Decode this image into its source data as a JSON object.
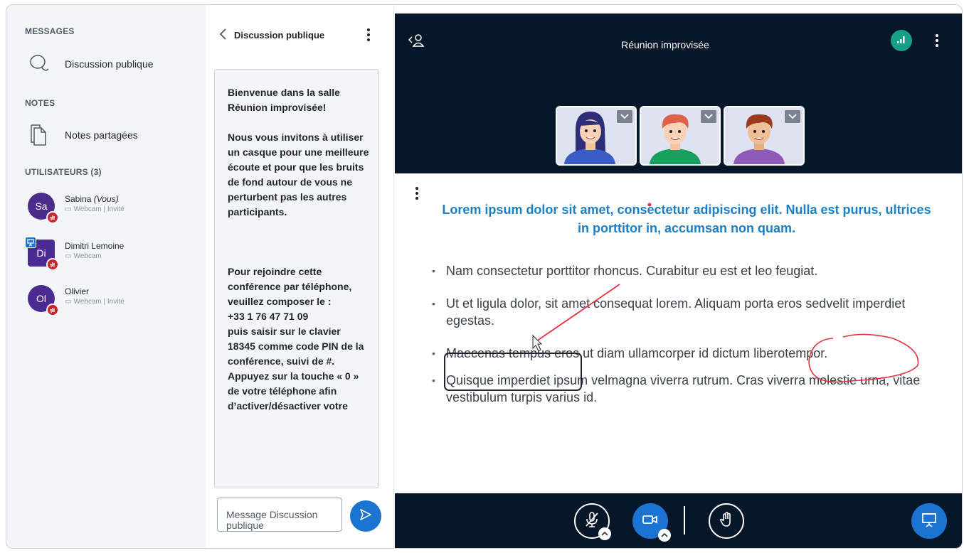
{
  "sidebar": {
    "messages_title": "MESSAGES",
    "public_chat_label": "Discussion publique",
    "notes_title": "NOTES",
    "shared_notes_label": "Notes partagées",
    "users_title": "UTILISATEURS (3)",
    "users": [
      {
        "initials": "Sa",
        "name": "Sabina",
        "you": "(Vous)",
        "status": "Webcam | Invité",
        "color": "#4a2c8a"
      },
      {
        "initials": "Di",
        "name": "Dimitri Lemoine",
        "you": "",
        "status": "Webcam",
        "color": "#4b2a91"
      },
      {
        "initials": "Ol",
        "name": "Olivier",
        "you": "",
        "status": "Webcam | Invité",
        "color": "#4b2a91"
      }
    ]
  },
  "chat": {
    "title": "Discussion publique",
    "welcome_lines": [
      "Bienvenue dans la salle Réunion improvisée!",
      "Nous vous invitons à utiliser un casque pour une meilleure écoute et pour que les bruits de fond autour de vous ne perturbent pas les autres participants.",
      "Pour rejoindre cette conférence par téléphone, veuillez composer le :",
      "+33 1 76 47 71 09",
      "puis saisir sur le clavier 18345 comme code PIN de la conférence, suivi de #.",
      "Appuyez sur la touche « 0 » de votre téléphone afin d’activer/désactiver votre"
    ],
    "input_placeholder": "Message Discussion publique"
  },
  "meeting": {
    "title": "Réunion improvisée",
    "colors": {
      "background": "#06172a",
      "accent": "#1b74d1",
      "connection": "#16a085",
      "slide_title": "#1c7ec4",
      "annotation": "#e53242"
    }
  },
  "slide": {
    "title": "Lorem ipsum dolor sit amet, consectetur adipiscing elit. Nulla est purus, ultrices in porttitor in, accumsan non quam.",
    "bullets": [
      "Nam consectetur porttitor rhoncus. Curabitur eu est et leo feugiat.",
      "Ut et ligula dolor, sit amet consequat lorem. Aliquam porta eros sedvelit imperdiet egestas.",
      "Maecenas tempus eros ut diam ullamcorper id dictum liberotempor.",
      "Quisque imperdiet ipsum velmagna viverra rutrum. Cras viverra molestie urna, vitae vestibulum turpis varius id."
    ]
  },
  "icons": {
    "public_chat": "chat-bubble-icon",
    "shared_notes": "notes-icon",
    "mute": "microphone-off-icon",
    "camera": "video-camera-icon",
    "raise_hand": "hand-icon",
    "presentation": "presentation-icon",
    "send": "send-icon",
    "connection": "signal-bars-icon"
  }
}
